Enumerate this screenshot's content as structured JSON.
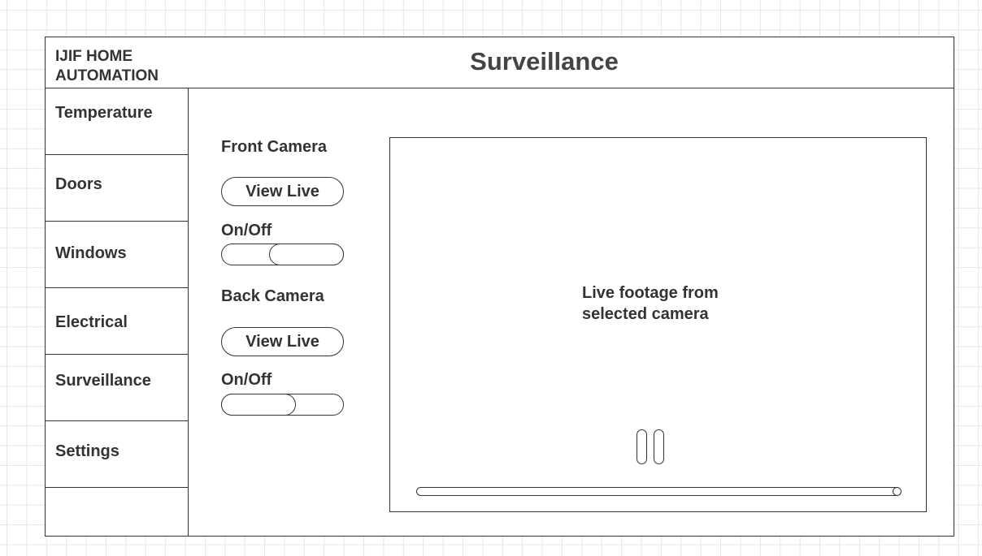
{
  "header": {
    "brand": "IJIF HOME\nAUTOMATION",
    "title": "Surveillance"
  },
  "sidebar": {
    "items": [
      {
        "label": "Temperature"
      },
      {
        "label": "Doors"
      },
      {
        "label": "Windows"
      },
      {
        "label": "Electrical"
      },
      {
        "label": "Surveillance",
        "active": true
      },
      {
        "label": "Settings"
      }
    ]
  },
  "cameras": [
    {
      "name": "Front Camera",
      "view_label": "View Live",
      "toggle_label": "On/Off",
      "toggle_state": "on"
    },
    {
      "name": "Back Camera",
      "view_label": "View Live",
      "toggle_label": "On/Off",
      "toggle_state": "off"
    }
  ],
  "video": {
    "caption": "Live footage from\nselected camera",
    "control_icon": "pause-icon",
    "progress": 1.0
  },
  "colors": {
    "stroke": "#333333",
    "text": "#333333",
    "grid": "#e6e6e6"
  }
}
